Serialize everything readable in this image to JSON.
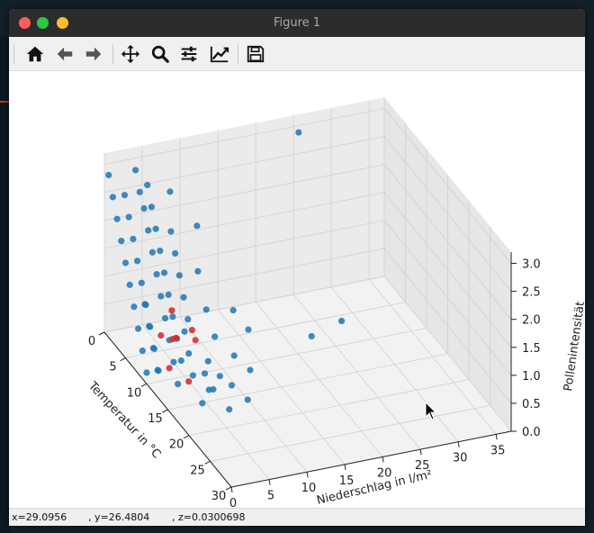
{
  "window": {
    "title": "Figure 1"
  },
  "toolbar": {
    "buttons": [
      {
        "name": "home-button",
        "icon": "home-icon"
      },
      {
        "name": "back-button",
        "icon": "arrow-left-icon"
      },
      {
        "name": "forward-button",
        "icon": "arrow-right-icon"
      },
      {
        "name": "pan-button",
        "icon": "move-icon"
      },
      {
        "name": "zoom-button",
        "icon": "search-icon"
      },
      {
        "name": "configure-subplots-button",
        "icon": "sliders-icon"
      },
      {
        "name": "edit-axis-button",
        "icon": "chart-line-icon"
      },
      {
        "name": "save-button",
        "icon": "floppy-disk-icon"
      }
    ]
  },
  "status": {
    "x": "x=29.0956",
    "y": ", y=26.4804",
    "z": ", z=0.0300698"
  },
  "chart_data": {
    "type": "scatter",
    "projection": "3d",
    "xlabel": "Temperatur in °C",
    "ylabel": "Niederschlag in l/m²",
    "zlabel": "Pollenintensität",
    "x_ticks": [
      "0",
      "5",
      "10",
      "15",
      "20",
      "25",
      "30"
    ],
    "y_ticks": [
      "0",
      "5",
      "10",
      "15",
      "20",
      "25",
      "30",
      "35"
    ],
    "z_ticks": [
      "0.0",
      "0.5",
      "1.0",
      "1.5",
      "2.0",
      "2.5",
      "3.0"
    ],
    "xlim": [
      0,
      30
    ],
    "ylim": [
      0,
      37
    ],
    "zlim": [
      0,
      3.2
    ],
    "grid": true,
    "series": [
      {
        "color": "#1f77b4",
        "points": [
          [
            1,
            0,
            2.9
          ],
          [
            2,
            0,
            2.6
          ],
          [
            3,
            0,
            2.3
          ],
          [
            4,
            0,
            2.0
          ],
          [
            5,
            0,
            1.7
          ],
          [
            6,
            0,
            1.4
          ],
          [
            7,
            0,
            1.1
          ],
          [
            8,
            0,
            0.8
          ],
          [
            9,
            0,
            0.5
          ],
          [
            10,
            0,
            0.2
          ],
          [
            3,
            1,
            2.7
          ],
          [
            4,
            1,
            2.4
          ],
          [
            5,
            1,
            2.1
          ],
          [
            6,
            1,
            1.8
          ],
          [
            7,
            1,
            1.5
          ],
          [
            8,
            1,
            1.2
          ],
          [
            9,
            1,
            0.9
          ],
          [
            10,
            1,
            0.6
          ],
          [
            11,
            1,
            0.3
          ],
          [
            2,
            3,
            3.0
          ],
          [
            3,
            3,
            2.7
          ],
          [
            4,
            3,
            2.5
          ],
          [
            5,
            3,
            2.2
          ],
          [
            6,
            3,
            1.9
          ],
          [
            7,
            3,
            1.6
          ],
          [
            8,
            3,
            1.3
          ],
          [
            9,
            3,
            1.0
          ],
          [
            10,
            3,
            0.7
          ],
          [
            11,
            3,
            0.4
          ],
          [
            12,
            3,
            0.1
          ],
          [
            3,
            4,
            2.8
          ],
          [
            4,
            4,
            2.5
          ],
          [
            5,
            4,
            2.2
          ],
          [
            6,
            4,
            1.9
          ],
          [
            7,
            4,
            1.6
          ],
          [
            8,
            4,
            1.3
          ],
          [
            9,
            4,
            1.0
          ],
          [
            10,
            4,
            0.7
          ],
          [
            11,
            4,
            0.4
          ],
          [
            6,
            2,
            1.0
          ],
          [
            7,
            2,
            0.7
          ],
          [
            8,
            2,
            0.4
          ],
          [
            9,
            2,
            0.1
          ],
          [
            5,
            6,
            2.1
          ],
          [
            6,
            6,
            1.8
          ],
          [
            7,
            6,
            1.5
          ],
          [
            8,
            6,
            1.2
          ],
          [
            9,
            6,
            0.9
          ],
          [
            10,
            5,
            0.8
          ],
          [
            11,
            5,
            0.5
          ],
          [
            12,
            5,
            0.2
          ],
          [
            13,
            6,
            0.3
          ],
          [
            14,
            6,
            0.1
          ],
          [
            12,
            7,
            0.4
          ],
          [
            8,
            9,
            0.9
          ],
          [
            10,
            9,
            0.6
          ],
          [
            11,
            11,
            0.3
          ],
          [
            13,
            8,
            0.2
          ],
          [
            17,
            7,
            0.0
          ],
          [
            16,
            4,
            0.1
          ],
          [
            15,
            6,
            0.2
          ],
          [
            14,
            9,
            0.1
          ],
          [
            4,
            10,
            2.0
          ],
          [
            6,
            9,
            1.4
          ],
          [
            3,
            7,
            2.6
          ],
          [
            9,
            14,
            0.5
          ],
          [
            9,
            12,
            0.9
          ],
          [
            15,
            19,
            0.8
          ],
          [
            13,
            12,
            0.2
          ],
          [
            16,
            10,
            0.0
          ],
          [
            3,
            24,
            3.2
          ],
          [
            6,
            28,
            0.0
          ]
        ]
      },
      {
        "color": "#d62728",
        "points": [
          [
            8,
            3,
            0.6
          ],
          [
            9,
            4,
            0.6
          ],
          [
            8,
            5,
            0.5
          ],
          [
            10,
            6,
            0.8
          ],
          [
            9,
            7,
            0.5
          ],
          [
            10,
            3,
            0.2
          ],
          [
            7,
            5,
            0.9
          ],
          [
            11,
            5,
            0.0
          ]
        ]
      }
    ]
  }
}
